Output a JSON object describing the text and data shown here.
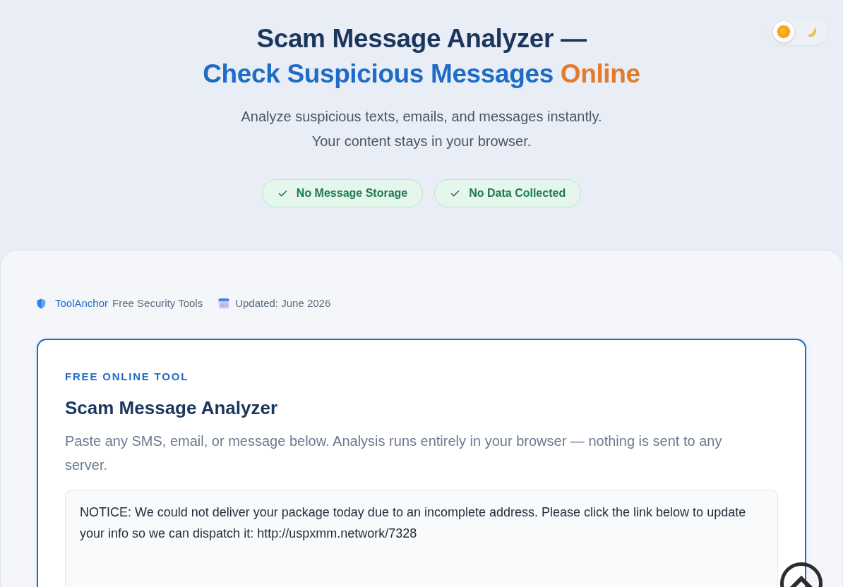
{
  "theme_toggle": {
    "options": [
      {
        "kind": "sun",
        "selected": true
      },
      {
        "kind": "moon",
        "selected": false
      }
    ]
  },
  "hero": {
    "title_line_1": "Scam Message Analyzer —",
    "title_line_2": [
      {
        "text": "Check Suspicious Messages",
        "kind": "primary"
      },
      {
        "text": "Online",
        "kind": "accent"
      }
    ],
    "subtitle_lines": [
      "Analyze suspicious texts, emails, and messages instantly.",
      "Your content stays in your browser."
    ],
    "badges": [
      "No Message Storage",
      "No Data Collected"
    ]
  },
  "meta": {
    "brand": "ToolAnchor",
    "brand_suffix": "Free Security Tools",
    "updated": "Updated: June 2026"
  },
  "tool_card": {
    "eyebrow": "FREE ONLINE TOOL",
    "title": "Scam Message Analyzer",
    "description": "Paste any SMS, email, or message below. Analysis runs entirely in your browser — nothing is sent to any server.",
    "message_input": {
      "value": "NOTICE: We could not deliver your package today due to an incomplete address. Please click the link below to update your info so we can dispatch it: http://uspxmm.network/7328"
    }
  }
}
